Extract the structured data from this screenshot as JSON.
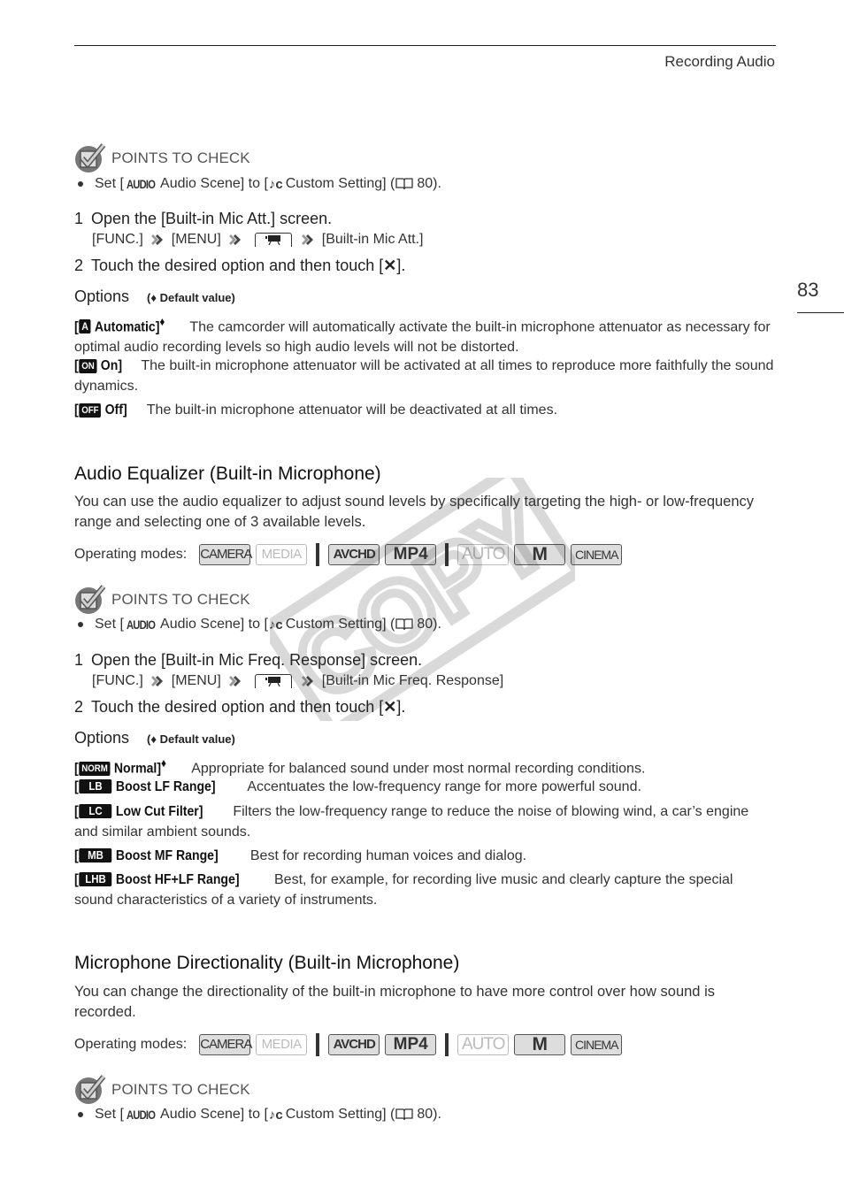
{
  "header": {
    "title": "Recording Audio",
    "page_number": "83"
  },
  "watermark": {
    "text": "COPY"
  },
  "points_to_check": {
    "label": "POINTS TO CHECK",
    "bullet": {
      "prefix": "Set [",
      "audio_icon": "AUDIO",
      "audio_scene": " Audio Scene] to [",
      "custom_icon": "♪c",
      "custom_setting": " Custom Setting] (",
      "page_ref": " 80)."
    }
  },
  "section1": {
    "step1": {
      "num": "1",
      "text": "Open the [Built-in Mic Att.] screen."
    },
    "path": [
      "[FUNC.]",
      "[MENU]",
      "[Built-in Mic Att.]"
    ],
    "step2": {
      "num": "2",
      "text_pre": "Touch the desired option and then touch [",
      "text_post": "]."
    },
    "options_label": "Options",
    "default_note": "(♦ Default value)",
    "options": [
      {
        "badge": "A",
        "name": "Automatic]",
        "default": "♦",
        "desc": "The camcorder will automatically activate the built-in microphone attenuator as necessary for optimal audio recording levels so high audio levels will not be distorted."
      },
      {
        "badge": "ON",
        "name": "On]",
        "default": "",
        "desc": "The built-in microphone attenuator will be activated at all times to reproduce more faithfully the sound dynamics."
      },
      {
        "badge": "OFF",
        "name": "Off]",
        "default": "",
        "desc": "The built-in microphone attenuator will be deactivated at all times."
      }
    ]
  },
  "section2": {
    "title": "Audio Equalizer (Built-in Microphone)",
    "intro": "You can use the audio equalizer to adjust sound levels by specifically targeting the high- or low-frequency range and selecting one of 3 available levels.",
    "operating_modes_label": "Operating modes:",
    "modes": [
      {
        "label": "CAMERA",
        "active": true
      },
      {
        "label": "MEDIA",
        "active": false
      },
      {
        "label": "AVCHD",
        "active": true
      },
      {
        "label": "MP4",
        "active": true
      },
      {
        "label": "AUTO",
        "active": false
      },
      {
        "label": "M",
        "active": true
      },
      {
        "label": "CINEMA",
        "active": true
      }
    ],
    "step1": {
      "num": "1",
      "text": "Open the [Built-in Mic Freq. Response] screen."
    },
    "path": [
      "[FUNC.]",
      "[MENU]",
      "[Built-in Mic Freq. Response]"
    ],
    "step2": {
      "num": "2",
      "text_pre": "Touch the desired option and then touch [",
      "text_post": "]."
    },
    "options_label": "Options",
    "default_note": "(♦ Default value)",
    "options": [
      {
        "badge": "NORM",
        "name": "Normal]",
        "default": "♦",
        "desc": "Appropriate for balanced sound under most normal recording conditions."
      },
      {
        "badge": "LB",
        "name": "Boost LF Range]",
        "default": "",
        "desc": "Accentuates the low-frequency range for more powerful sound."
      },
      {
        "badge": "LC",
        "name": "Low Cut Filter]",
        "default": "",
        "desc": "Filters the low-frequency range to reduce the noise of blowing wind, a car’s engine and similar ambient sounds."
      },
      {
        "badge": "MB",
        "name": "Boost MF Range]",
        "default": "",
        "desc": "Best for recording human voices and dialog."
      },
      {
        "badge": "LHB",
        "name": "Boost HF+LF Range]",
        "default": "",
        "desc": "Best, for example, for recording live music and clearly capture the special sound characteristics of a variety of instruments."
      }
    ]
  },
  "section3": {
    "title": "Microphone Directionality (Built-in Microphone)",
    "intro": "You can change the directionality of the built-in microphone to have more control over how sound is recorded.",
    "operating_modes_label": "Operating modes:"
  }
}
